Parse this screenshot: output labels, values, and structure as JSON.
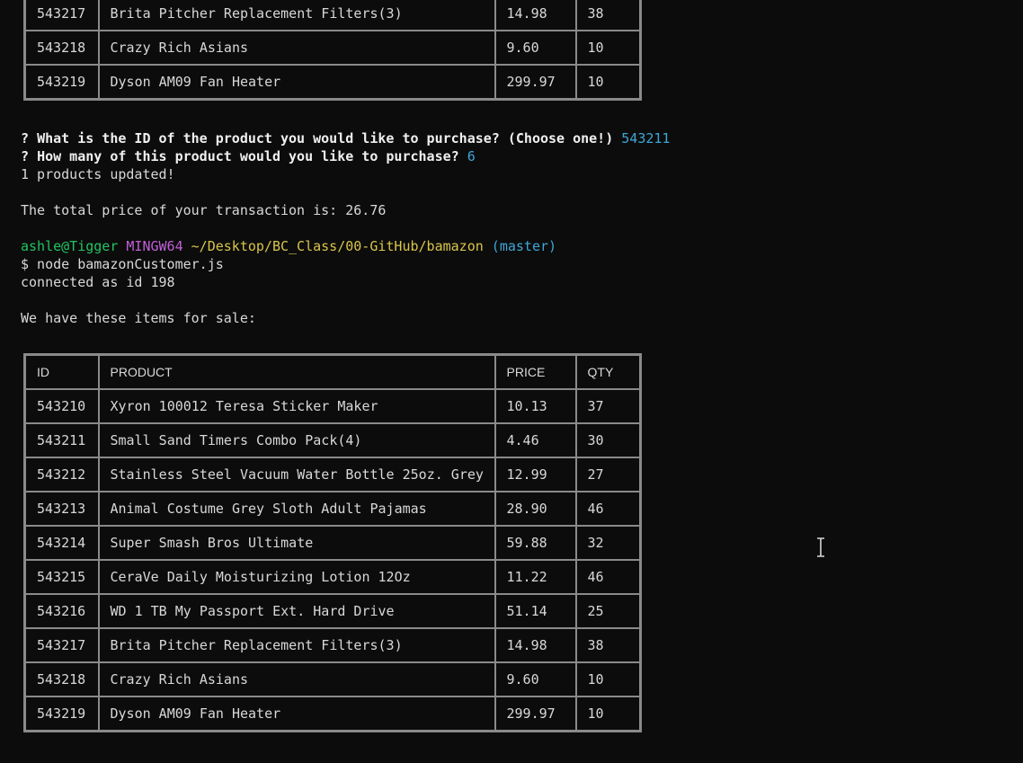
{
  "top_table": {
    "rows": [
      {
        "id": "543217",
        "product": "Brita Pitcher Replacement Filters(3)",
        "price": "14.98",
        "qty": "38"
      },
      {
        "id": "543218",
        "product": "Crazy Rich Asians",
        "price": "9.60",
        "qty": "10"
      },
      {
        "id": "543219",
        "product": "Dyson AM09 Fan Heater",
        "price": "299.97",
        "qty": "10"
      }
    ]
  },
  "prompts": {
    "q1_mark": "?",
    "q1_text": "What is the ID of the product you would like to purchase? (Choose one!)",
    "q1_answer": "543211",
    "q2_mark": "?",
    "q2_text": "How many of this product would you like to purchase?",
    "q2_answer": "6",
    "updated": "1 products updated!",
    "total": "The total price of your transaction is: 26.76"
  },
  "shell": {
    "user": "ashle@Tigger",
    "host": "MINGW64",
    "path": "~/Desktop/BC_Class/00-GitHub/bamazon",
    "branch": "(master)",
    "command": "$ node bamazonCustomer.js",
    "connected": "connected as id 198",
    "sale_intro": "We have these items for sale:"
  },
  "main_table": {
    "headers": {
      "id": "ID",
      "product": "PRODUCT",
      "price": "PRICE",
      "qty": "QTY"
    },
    "rows": [
      {
        "id": "543210",
        "product": "Xyron 100012 Teresa Sticker Maker",
        "price": "10.13",
        "qty": "37"
      },
      {
        "id": "543211",
        "product": "Small Sand Timers Combo Pack(4)",
        "price": "4.46",
        "qty": "30"
      },
      {
        "id": "543212",
        "product": "Stainless Steel Vacuum Water Bottle 25oz. Grey",
        "price": "12.99",
        "qty": "27"
      },
      {
        "id": "543213",
        "product": "Animal Costume Grey Sloth Adult Pajamas",
        "price": "28.90",
        "qty": "46"
      },
      {
        "id": "543214",
        "product": "Super Smash Bros Ultimate",
        "price": "59.88",
        "qty": "32"
      },
      {
        "id": "543215",
        "product": "CeraVe Daily Moisturizing Lotion 12Oz",
        "price": "11.22",
        "qty": "46"
      },
      {
        "id": "543216",
        "product": "WD 1 TB My Passport Ext. Hard Drive",
        "price": "51.14",
        "qty": "25"
      },
      {
        "id": "543217",
        "product": "Brita Pitcher Replacement Filters(3)",
        "price": "14.98",
        "qty": "38"
      },
      {
        "id": "543218",
        "product": "Crazy Rich Asians",
        "price": "9.60",
        "qty": "10"
      },
      {
        "id": "543219",
        "product": "Dyson AM09 Fan Heater",
        "price": "299.97",
        "qty": "10"
      }
    ]
  },
  "colors": {
    "background": "#0c0c0c",
    "text": "#d8d8d8",
    "border": "#8a8a8a",
    "answer": "#3ea7d8",
    "user": "#23c464",
    "host": "#c25fd6",
    "path": "#d9c54a"
  },
  "icons": {
    "cursor": "text-ibeam-cursor-icon"
  }
}
